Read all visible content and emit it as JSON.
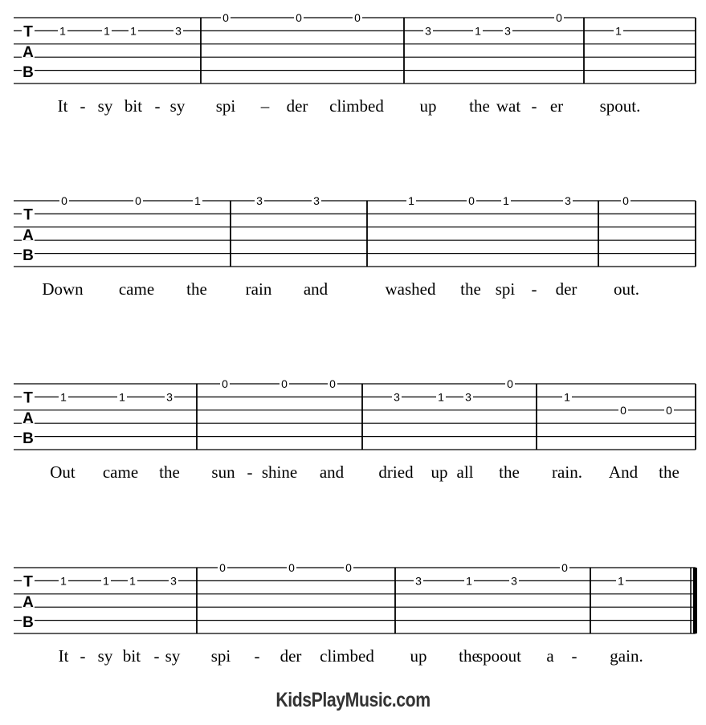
{
  "tab_clef": [
    "T",
    "A",
    "B"
  ],
  "strings": 6,
  "systems": [
    {
      "measures": [
        {
          "notes": [
            {
              "string": 2,
              "fret": "1"
            },
            {
              "string": 2,
              "fret": "1"
            },
            {
              "string": 2,
              "fret": "1"
            },
            {
              "string": 2,
              "fret": "3"
            }
          ]
        },
        {
          "notes": [
            {
              "string": 1,
              "fret": "0"
            },
            {
              "string": 1,
              "fret": "0"
            },
            {
              "string": 1,
              "fret": "0"
            }
          ]
        },
        {
          "notes": [
            {
              "string": 2,
              "fret": "3"
            },
            {
              "string": 2,
              "fret": "1"
            },
            {
              "string": 2,
              "fret": "3"
            },
            {
              "string": 1,
              "fret": "0"
            }
          ]
        },
        {
          "notes": [
            {
              "string": 2,
              "fret": "1"
            }
          ]
        }
      ],
      "lyrics": [
        "It",
        "-",
        "sy",
        "bit",
        "-",
        "sy",
        "spi",
        "–",
        "der",
        "climbed",
        "up",
        "the",
        "wat",
        "-",
        "er",
        "spout."
      ]
    },
    {
      "measures": [
        {
          "notes": [
            {
              "string": 1,
              "fret": "0"
            },
            {
              "string": 1,
              "fret": "0"
            },
            {
              "string": 1,
              "fret": "1"
            }
          ]
        },
        {
          "notes": [
            {
              "string": 1,
              "fret": "3"
            },
            {
              "string": 1,
              "fret": "3"
            }
          ]
        },
        {
          "notes": [
            {
              "string": 1,
              "fret": "1"
            },
            {
              "string": 1,
              "fret": "0"
            },
            {
              "string": 1,
              "fret": "1"
            },
            {
              "string": 1,
              "fret": "3"
            }
          ]
        },
        {
          "notes": [
            {
              "string": 1,
              "fret": "0"
            }
          ]
        }
      ],
      "lyrics": [
        "Down",
        "came",
        "the",
        "rain",
        "and",
        "washed",
        "the",
        "spi",
        "-",
        "der",
        "out."
      ]
    },
    {
      "measures": [
        {
          "notes": [
            {
              "string": 2,
              "fret": "1"
            },
            {
              "string": 2,
              "fret": "1"
            },
            {
              "string": 2,
              "fret": "3"
            }
          ]
        },
        {
          "notes": [
            {
              "string": 1,
              "fret": "0"
            },
            {
              "string": 1,
              "fret": "0"
            },
            {
              "string": 1,
              "fret": "0"
            }
          ]
        },
        {
          "notes": [
            {
              "string": 2,
              "fret": "3"
            },
            {
              "string": 2,
              "fret": "1"
            },
            {
              "string": 2,
              "fret": "3"
            },
            {
              "string": 1,
              "fret": "0"
            }
          ]
        },
        {
          "notes": [
            {
              "string": 2,
              "fret": "1"
            },
            {
              "string": 3,
              "fret": "0"
            },
            {
              "string": 3,
              "fret": "0"
            }
          ]
        }
      ],
      "lyrics": [
        "Out",
        "came",
        "the",
        "sun",
        "-",
        "shine",
        "and",
        "dried",
        "up",
        "all",
        "the",
        "rain.",
        "And",
        "the"
      ]
    },
    {
      "measures": [
        {
          "notes": [
            {
              "string": 2,
              "fret": "1"
            },
            {
              "string": 2,
              "fret": "1"
            },
            {
              "string": 2,
              "fret": "1"
            },
            {
              "string": 2,
              "fret": "3"
            }
          ]
        },
        {
          "notes": [
            {
              "string": 1,
              "fret": "0"
            },
            {
              "string": 1,
              "fret": "0"
            },
            {
              "string": 1,
              "fret": "0"
            }
          ]
        },
        {
          "notes": [
            {
              "string": 2,
              "fret": "3"
            },
            {
              "string": 2,
              "fret": "1"
            },
            {
              "string": 2,
              "fret": "3"
            },
            {
              "string": 1,
              "fret": "0"
            }
          ]
        },
        {
          "notes": [
            {
              "string": 2,
              "fret": "1"
            }
          ]
        }
      ],
      "lyrics": [
        "It",
        "-",
        "sy",
        "bit",
        "-",
        "sy",
        "spi",
        "-",
        "der",
        "climbed",
        "up",
        "the",
        "spoout",
        "a",
        "-",
        "gain."
      ],
      "final_barline": true
    }
  ],
  "footer": {
    "site": "KidsPlayMusic.com"
  }
}
